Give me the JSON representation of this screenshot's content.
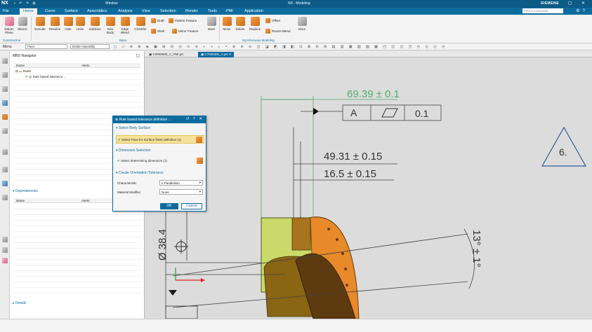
{
  "titlebar": {
    "logo": "NX",
    "window_menu": "Window",
    "title": "NX - Modeling",
    "brand": "SIEMENS"
  },
  "menu": {
    "tabs": [
      "File",
      "Home",
      "Curve",
      "Surface",
      "Assemblies",
      "Analysis",
      "View",
      "Selection",
      "Render",
      "Tools",
      "PMI",
      "Application"
    ],
    "active": "Home",
    "find_placeholder": "Find a Command"
  },
  "ribbon": {
    "datum_plane": "Datum Plane",
    "sketch": "Sketch",
    "extrude": "Extrude",
    "revolve": "Revolve",
    "hole": "Hole",
    "unite": "Unite",
    "subtract": "Subtract",
    "sew_body": "Sew Body",
    "edge_blend": "Edge Blend",
    "chamfer": "Chamfer",
    "draft": "Draft",
    "pattern_feature": "Pattern Feature",
    "shell": "Shell",
    "mirror_feature": "Mirror Feature",
    "more1": "More",
    "move": "Move",
    "delete": "Delete",
    "replace": "Replace",
    "offset": "Offset",
    "resize_blend": "Resize Blend",
    "more2": "More",
    "group_construction": "Construction",
    "group_base": "Base",
    "group_sync": "Synchronous Modeling"
  },
  "selbar": {
    "menu": "Menu",
    "filter": "Face",
    "scope": "Entire Assembly"
  },
  "navigator": {
    "title": "MBD Navigator",
    "col_name": "Name",
    "col_alerts": "Alerts",
    "rules": "Rules",
    "rule_item": "Rule based tolerance ...",
    "dependencies": "Dependencies",
    "dep_col_name": "Name",
    "dep_col_alerts": "Alerts",
    "details": "Details"
  },
  "graphics_tabs": [
    "C9999999_C_PMI.prt",
    "C7000381_A.prt"
  ],
  "dialog": {
    "title": "Rule based tolerance definition ...",
    "sec1": "Select Body Surface",
    "sec1_row": "Select Face for Surface finish definition (1)",
    "sec2": "Dimension Selection",
    "sec2_row": "Select determining dimension (1)",
    "sec3": "Create Orientation Tolerance",
    "characteristic_label": "Characteristic",
    "characteristic_value": "// Parallelism",
    "modifier_label": "Material Modifier",
    "modifier_value": "None",
    "ok": "OK",
    "cancel": "Cancel"
  },
  "drawing": {
    "dim_top": "69.39  ± 0.1",
    "fcf_datum": "A",
    "fcf_value": "0.1",
    "dim_mid": "49.31  ± 0.15",
    "dim_low": "16.5  ± 0.15",
    "diameter": "Ø 38.4",
    "angle": "13°  ± 1°",
    "triangle_note": "6."
  },
  "colors": {
    "accent": "#0d6c9f",
    "part_orange": "#e8892a",
    "part_yellow": "#c9d96a",
    "dim_green": "#4fae6a"
  }
}
